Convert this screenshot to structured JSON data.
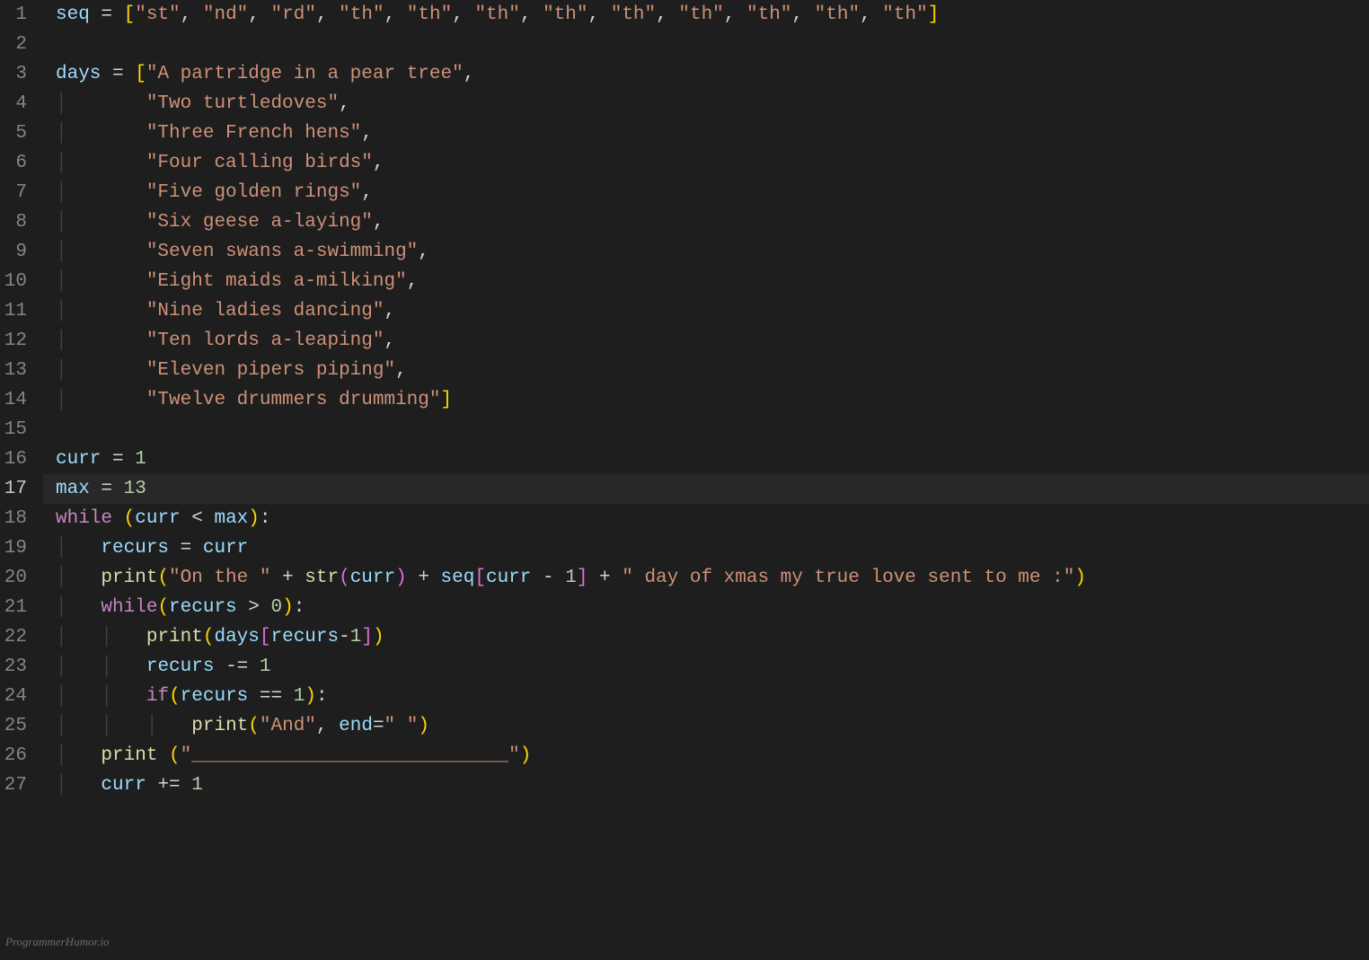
{
  "editor": {
    "active_line": 17,
    "watermark": "ProgrammerHumor.io",
    "lines": [
      {
        "num": 1,
        "indent": "",
        "tokens": [
          [
            "var",
            "seq"
          ],
          [
            "op",
            " = "
          ],
          [
            "brack",
            "["
          ],
          [
            "str",
            "\"st\""
          ],
          [
            "punc",
            ", "
          ],
          [
            "str",
            "\"nd\""
          ],
          [
            "punc",
            ", "
          ],
          [
            "str",
            "\"rd\""
          ],
          [
            "punc",
            ", "
          ],
          [
            "str",
            "\"th\""
          ],
          [
            "punc",
            ", "
          ],
          [
            "str",
            "\"th\""
          ],
          [
            "punc",
            ", "
          ],
          [
            "str",
            "\"th\""
          ],
          [
            "punc",
            ", "
          ],
          [
            "str",
            "\"th\""
          ],
          [
            "punc",
            ", "
          ],
          [
            "str",
            "\"th\""
          ],
          [
            "punc",
            ", "
          ],
          [
            "str",
            "\"th\""
          ],
          [
            "punc",
            ", "
          ],
          [
            "str",
            "\"th\""
          ],
          [
            "punc",
            ", "
          ],
          [
            "str",
            "\"th\""
          ],
          [
            "punc",
            ", "
          ],
          [
            "str",
            "\"th\""
          ],
          [
            "brack",
            "]"
          ]
        ]
      },
      {
        "num": 2,
        "indent": "",
        "tokens": []
      },
      {
        "num": 3,
        "indent": "",
        "tokens": [
          [
            "var",
            "days"
          ],
          [
            "op",
            " = "
          ],
          [
            "brack",
            "["
          ],
          [
            "str",
            "\"A partridge in a pear tree\""
          ],
          [
            "punc",
            ","
          ]
        ]
      },
      {
        "num": 4,
        "indent": "|       ",
        "tokens": [
          [
            "str",
            "\"Two turtledoves\""
          ],
          [
            "punc",
            ","
          ]
        ]
      },
      {
        "num": 5,
        "indent": "|       ",
        "tokens": [
          [
            "str",
            "\"Three French hens\""
          ],
          [
            "punc",
            ","
          ]
        ]
      },
      {
        "num": 6,
        "indent": "|       ",
        "tokens": [
          [
            "str",
            "\"Four calling birds\""
          ],
          [
            "punc",
            ","
          ]
        ]
      },
      {
        "num": 7,
        "indent": "|       ",
        "tokens": [
          [
            "str",
            "\"Five golden rings\""
          ],
          [
            "punc",
            ","
          ]
        ]
      },
      {
        "num": 8,
        "indent": "|       ",
        "tokens": [
          [
            "str",
            "\"Six geese a-laying\""
          ],
          [
            "punc",
            ","
          ]
        ]
      },
      {
        "num": 9,
        "indent": "|       ",
        "tokens": [
          [
            "str",
            "\"Seven swans a-swimming\""
          ],
          [
            "punc",
            ","
          ]
        ]
      },
      {
        "num": 10,
        "indent": "|       ",
        "tokens": [
          [
            "str",
            "\"Eight maids a-milking\""
          ],
          [
            "punc",
            ","
          ]
        ]
      },
      {
        "num": 11,
        "indent": "|       ",
        "tokens": [
          [
            "str",
            "\"Nine ladies dancing\""
          ],
          [
            "punc",
            ","
          ]
        ]
      },
      {
        "num": 12,
        "indent": "|       ",
        "tokens": [
          [
            "str",
            "\"Ten lords a-leaping\""
          ],
          [
            "punc",
            ","
          ]
        ]
      },
      {
        "num": 13,
        "indent": "|       ",
        "tokens": [
          [
            "str",
            "\"Eleven pipers piping\""
          ],
          [
            "punc",
            ","
          ]
        ]
      },
      {
        "num": 14,
        "indent": "|       ",
        "tokens": [
          [
            "str",
            "\"Twelve drummers drumming\""
          ],
          [
            "brack",
            "]"
          ]
        ]
      },
      {
        "num": 15,
        "indent": "",
        "tokens": []
      },
      {
        "num": 16,
        "indent": "",
        "tokens": [
          [
            "var",
            "curr"
          ],
          [
            "op",
            " = "
          ],
          [
            "num",
            "1"
          ]
        ]
      },
      {
        "num": 17,
        "indent": "",
        "tokens": [
          [
            "var",
            "max"
          ],
          [
            "op",
            " = "
          ],
          [
            "num",
            "13"
          ]
        ]
      },
      {
        "num": 18,
        "indent": "",
        "tokens": [
          [
            "kw",
            "while"
          ],
          [
            "op",
            " "
          ],
          [
            "brack",
            "("
          ],
          [
            "var",
            "curr"
          ],
          [
            "op",
            " < "
          ],
          [
            "var",
            "max"
          ],
          [
            "brack",
            ")"
          ],
          [
            "punc",
            ":"
          ]
        ]
      },
      {
        "num": 19,
        "indent": "|   ",
        "tokens": [
          [
            "var",
            "recurs"
          ],
          [
            "op",
            " = "
          ],
          [
            "var",
            "curr"
          ]
        ]
      },
      {
        "num": 20,
        "indent": "|   ",
        "tokens": [
          [
            "func",
            "print"
          ],
          [
            "brack",
            "("
          ],
          [
            "str",
            "\"On the \""
          ],
          [
            "op",
            " + "
          ],
          [
            "func",
            "str"
          ],
          [
            "brack2",
            "("
          ],
          [
            "var",
            "curr"
          ],
          [
            "brack2",
            ")"
          ],
          [
            "op",
            " + "
          ],
          [
            "var",
            "seq"
          ],
          [
            "brack2",
            "["
          ],
          [
            "var",
            "curr"
          ],
          [
            "op",
            " - "
          ],
          [
            "num",
            "1"
          ],
          [
            "brack2",
            "]"
          ],
          [
            "op",
            " + "
          ],
          [
            "str",
            "\" day of xmas my true love sent to me :\""
          ],
          [
            "brack",
            ")"
          ]
        ]
      },
      {
        "num": 21,
        "indent": "|   ",
        "tokens": [
          [
            "kw",
            "while"
          ],
          [
            "brack",
            "("
          ],
          [
            "var",
            "recurs"
          ],
          [
            "op",
            " > "
          ],
          [
            "num",
            "0"
          ],
          [
            "brack",
            ")"
          ],
          [
            "punc",
            ":"
          ]
        ]
      },
      {
        "num": 22,
        "indent": "|   |   ",
        "tokens": [
          [
            "func",
            "print"
          ],
          [
            "brack",
            "("
          ],
          [
            "var",
            "days"
          ],
          [
            "brack2",
            "["
          ],
          [
            "var",
            "recurs"
          ],
          [
            "op",
            "-"
          ],
          [
            "num",
            "1"
          ],
          [
            "brack2",
            "]"
          ],
          [
            "brack",
            ")"
          ]
        ]
      },
      {
        "num": 23,
        "indent": "|   |   ",
        "tokens": [
          [
            "var",
            "recurs"
          ],
          [
            "op",
            " -= "
          ],
          [
            "num",
            "1"
          ]
        ]
      },
      {
        "num": 24,
        "indent": "|   |   ",
        "tokens": [
          [
            "kw",
            "if"
          ],
          [
            "brack",
            "("
          ],
          [
            "var",
            "recurs"
          ],
          [
            "op",
            " == "
          ],
          [
            "num",
            "1"
          ],
          [
            "brack",
            ")"
          ],
          [
            "punc",
            ":"
          ]
        ]
      },
      {
        "num": 25,
        "indent": "|   |   |   ",
        "tokens": [
          [
            "func",
            "print"
          ],
          [
            "brack",
            "("
          ],
          [
            "str",
            "\"And\""
          ],
          [
            "punc",
            ", "
          ],
          [
            "param",
            "end"
          ],
          [
            "op",
            "="
          ],
          [
            "str",
            "\" \""
          ],
          [
            "brack",
            ")"
          ]
        ]
      },
      {
        "num": 26,
        "indent": "|   ",
        "tokens": [
          [
            "func",
            "print"
          ],
          [
            "op",
            " "
          ],
          [
            "brack",
            "("
          ],
          [
            "str",
            "\"____________________________\""
          ],
          [
            "brack",
            ")"
          ]
        ]
      },
      {
        "num": 27,
        "indent": "|   ",
        "tokens": [
          [
            "var",
            "curr"
          ],
          [
            "op",
            " += "
          ],
          [
            "num",
            "1"
          ]
        ]
      }
    ]
  }
}
